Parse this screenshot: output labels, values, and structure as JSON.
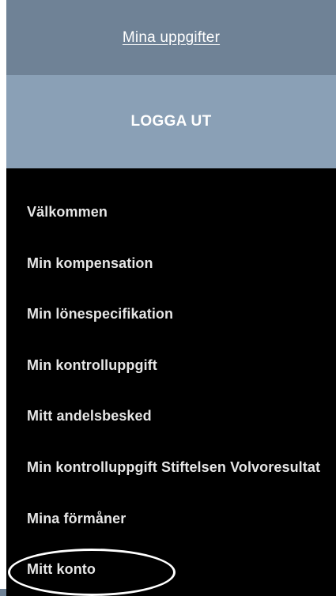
{
  "header": {
    "link_label": "Mina uppgifter",
    "logout_label": "LOGGA UT"
  },
  "nav": {
    "items": [
      {
        "label": "Välkommen"
      },
      {
        "label": "Min kompensation"
      },
      {
        "label": "Min lönespecifikation"
      },
      {
        "label": "Min kontrolluppgift"
      },
      {
        "label": "Mitt andelsbesked"
      },
      {
        "label": "Min kontrolluppgift Stiftelsen Volvoresultat"
      },
      {
        "label": "Mina förmåner"
      },
      {
        "label": "Mitt konto"
      }
    ]
  },
  "colors": {
    "header_bg": "#6f8296",
    "logout_bg": "#8aa0b6",
    "menu_bg": "#000000",
    "menu_text": "#e6e6e6"
  }
}
